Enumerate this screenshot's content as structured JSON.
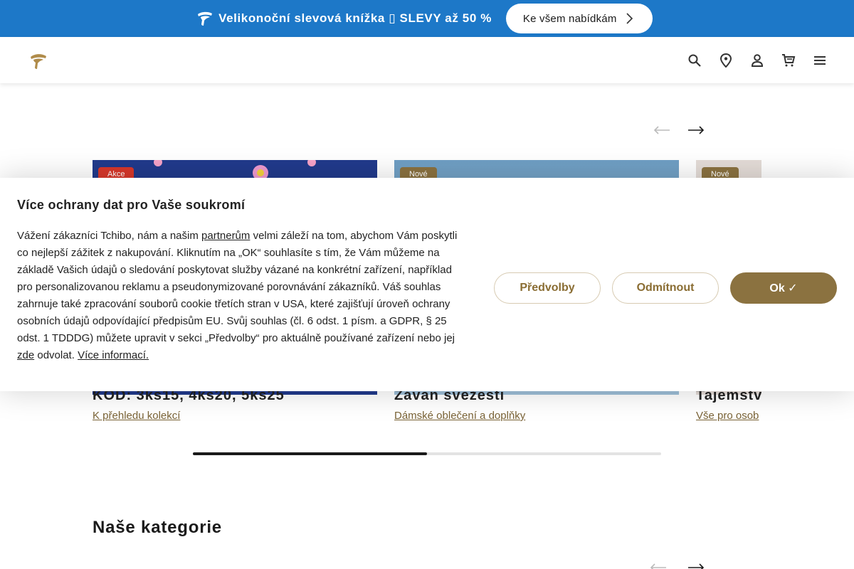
{
  "promo": {
    "text": "Velikonoční slevová knížka ▯ SLEVY až 50 %",
    "button_label": "Ke všem nabídkám"
  },
  "header": {
    "icons": [
      "search-icon",
      "location-pin-icon",
      "account-icon",
      "cart-icon",
      "menu-icon"
    ]
  },
  "carousel": {
    "progress_fraction": 0.5,
    "cards": [
      {
        "badge": "Akce",
        "title": "KÓD: 3ks15, 4ks20, 5ks25",
        "link": "K přehledu kolekcí"
      },
      {
        "badge": "Nové",
        "title": "Závan svěžesti",
        "link": "Dámské oblečení a doplňky"
      },
      {
        "badge": "Nové",
        "title": "Tajemství",
        "link": "Vše pro osob"
      }
    ]
  },
  "categories": {
    "title": "Naše kategorie"
  },
  "consent": {
    "title": "Více ochrany dat pro Vaše soukromí",
    "body_1": "Vážení zákazníci Tchibo, nám a našim ",
    "link_partners": "partnerům",
    "body_2": " velmi záleží na tom, abychom Vám poskytli co nejlepší zážitek z nakupování. Kliknutím na „OK“ souhlasíte s tím, že Vám můžeme na základě Vašich údajů o sledování poskytovat služby vázané na konkrétní zařízení, například pro personalizovanou reklamu a pseudonymizované porovnávání zákazníků. Váš souhlas zahrnuje také zpracování souborů cookie třetích stran v USA, které zajišťují úroveň ochrany osobních údajů odpovídající předpisům EU. Svůj souhlas (čl. 6 odst. 1 písm. a GDPR, § 25 odst. 1 TDDDG) můžete upravit v sekci „Předvolby“ pro aktuálně používané zařízení nebo jej ",
    "link_here": "zde",
    "body_3": " odvolat. ",
    "link_more": "Více informací.",
    "btn_preferences": "Předvolby",
    "btn_reject": "Odmítnout",
    "btn_ok": "Ok ✓"
  },
  "colors": {
    "promo_bg": "#1d78c8",
    "accent": "#8b7240",
    "badge_sale": "#d8372a"
  }
}
